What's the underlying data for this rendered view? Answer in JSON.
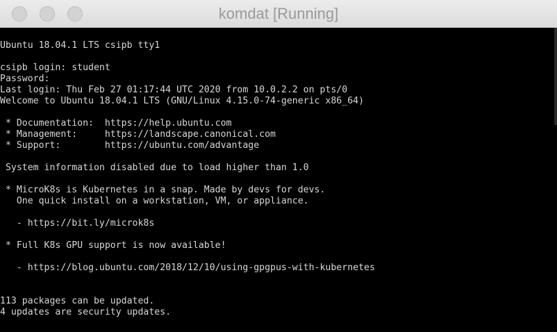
{
  "window": {
    "title": "komdat [Running]"
  },
  "terminal": {
    "lines": [
      "Ubuntu 18.04.1 LTS csipb tty1",
      "",
      "csipb login: student",
      "Password:",
      "Last login: Thu Feb 27 01:17:44 UTC 2020 from 10.0.2.2 on pts/0",
      "Welcome to Ubuntu 18.04.1 LTS (GNU/Linux 4.15.0-74-generic x86_64)",
      "",
      " * Documentation:  https://help.ubuntu.com",
      " * Management:     https://landscape.canonical.com",
      " * Support:        https://ubuntu.com/advantage",
      "",
      " System information disabled due to load higher than 1.0",
      "",
      " * MicroK8s is Kubernetes in a snap. Made by devs for devs.",
      "   One quick install on a workstation, VM, or appliance.",
      "",
      "   - https://bit.ly/microk8s",
      "",
      " * Full K8s GPU support is now available!",
      "",
      "   - https://blog.ubuntu.com/2018/12/10/using-gpgpus-with-kubernetes",
      "",
      "",
      "113 packages can be updated.",
      "4 updates are security updates."
    ]
  }
}
